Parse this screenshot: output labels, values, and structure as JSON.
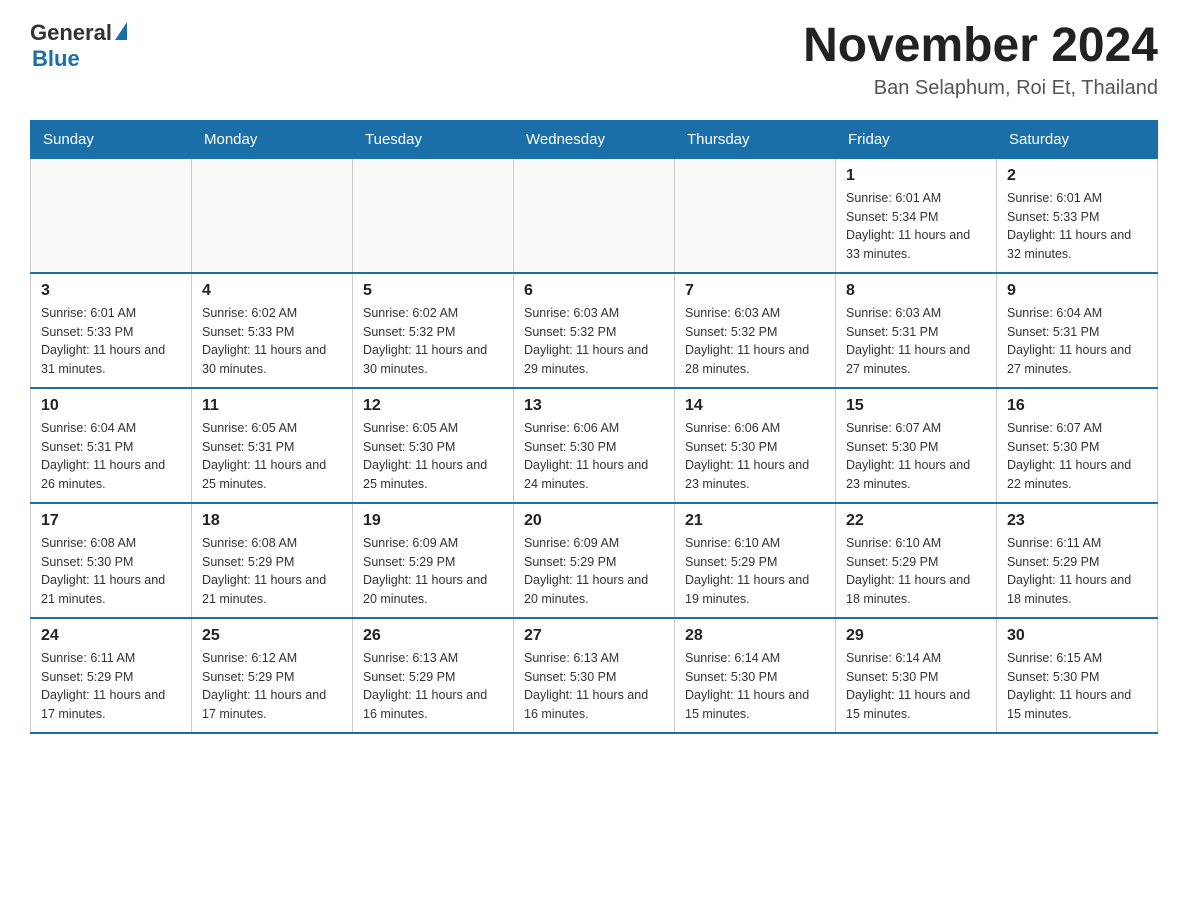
{
  "header": {
    "logo_general": "General",
    "logo_blue": "Blue",
    "month_title": "November 2024",
    "location": "Ban Selaphum, Roi Et, Thailand"
  },
  "weekdays": [
    "Sunday",
    "Monday",
    "Tuesday",
    "Wednesday",
    "Thursday",
    "Friday",
    "Saturday"
  ],
  "weeks": [
    [
      {
        "day": "",
        "info": ""
      },
      {
        "day": "",
        "info": ""
      },
      {
        "day": "",
        "info": ""
      },
      {
        "day": "",
        "info": ""
      },
      {
        "day": "",
        "info": ""
      },
      {
        "day": "1",
        "info": "Sunrise: 6:01 AM\nSunset: 5:34 PM\nDaylight: 11 hours and 33 minutes."
      },
      {
        "day": "2",
        "info": "Sunrise: 6:01 AM\nSunset: 5:33 PM\nDaylight: 11 hours and 32 minutes."
      }
    ],
    [
      {
        "day": "3",
        "info": "Sunrise: 6:01 AM\nSunset: 5:33 PM\nDaylight: 11 hours and 31 minutes."
      },
      {
        "day": "4",
        "info": "Sunrise: 6:02 AM\nSunset: 5:33 PM\nDaylight: 11 hours and 30 minutes."
      },
      {
        "day": "5",
        "info": "Sunrise: 6:02 AM\nSunset: 5:32 PM\nDaylight: 11 hours and 30 minutes."
      },
      {
        "day": "6",
        "info": "Sunrise: 6:03 AM\nSunset: 5:32 PM\nDaylight: 11 hours and 29 minutes."
      },
      {
        "day": "7",
        "info": "Sunrise: 6:03 AM\nSunset: 5:32 PM\nDaylight: 11 hours and 28 minutes."
      },
      {
        "day": "8",
        "info": "Sunrise: 6:03 AM\nSunset: 5:31 PM\nDaylight: 11 hours and 27 minutes."
      },
      {
        "day": "9",
        "info": "Sunrise: 6:04 AM\nSunset: 5:31 PM\nDaylight: 11 hours and 27 minutes."
      }
    ],
    [
      {
        "day": "10",
        "info": "Sunrise: 6:04 AM\nSunset: 5:31 PM\nDaylight: 11 hours and 26 minutes."
      },
      {
        "day": "11",
        "info": "Sunrise: 6:05 AM\nSunset: 5:31 PM\nDaylight: 11 hours and 25 minutes."
      },
      {
        "day": "12",
        "info": "Sunrise: 6:05 AM\nSunset: 5:30 PM\nDaylight: 11 hours and 25 minutes."
      },
      {
        "day": "13",
        "info": "Sunrise: 6:06 AM\nSunset: 5:30 PM\nDaylight: 11 hours and 24 minutes."
      },
      {
        "day": "14",
        "info": "Sunrise: 6:06 AM\nSunset: 5:30 PM\nDaylight: 11 hours and 23 minutes."
      },
      {
        "day": "15",
        "info": "Sunrise: 6:07 AM\nSunset: 5:30 PM\nDaylight: 11 hours and 23 minutes."
      },
      {
        "day": "16",
        "info": "Sunrise: 6:07 AM\nSunset: 5:30 PM\nDaylight: 11 hours and 22 minutes."
      }
    ],
    [
      {
        "day": "17",
        "info": "Sunrise: 6:08 AM\nSunset: 5:30 PM\nDaylight: 11 hours and 21 minutes."
      },
      {
        "day": "18",
        "info": "Sunrise: 6:08 AM\nSunset: 5:29 PM\nDaylight: 11 hours and 21 minutes."
      },
      {
        "day": "19",
        "info": "Sunrise: 6:09 AM\nSunset: 5:29 PM\nDaylight: 11 hours and 20 minutes."
      },
      {
        "day": "20",
        "info": "Sunrise: 6:09 AM\nSunset: 5:29 PM\nDaylight: 11 hours and 20 minutes."
      },
      {
        "day": "21",
        "info": "Sunrise: 6:10 AM\nSunset: 5:29 PM\nDaylight: 11 hours and 19 minutes."
      },
      {
        "day": "22",
        "info": "Sunrise: 6:10 AM\nSunset: 5:29 PM\nDaylight: 11 hours and 18 minutes."
      },
      {
        "day": "23",
        "info": "Sunrise: 6:11 AM\nSunset: 5:29 PM\nDaylight: 11 hours and 18 minutes."
      }
    ],
    [
      {
        "day": "24",
        "info": "Sunrise: 6:11 AM\nSunset: 5:29 PM\nDaylight: 11 hours and 17 minutes."
      },
      {
        "day": "25",
        "info": "Sunrise: 6:12 AM\nSunset: 5:29 PM\nDaylight: 11 hours and 17 minutes."
      },
      {
        "day": "26",
        "info": "Sunrise: 6:13 AM\nSunset: 5:29 PM\nDaylight: 11 hours and 16 minutes."
      },
      {
        "day": "27",
        "info": "Sunrise: 6:13 AM\nSunset: 5:30 PM\nDaylight: 11 hours and 16 minutes."
      },
      {
        "day": "28",
        "info": "Sunrise: 6:14 AM\nSunset: 5:30 PM\nDaylight: 11 hours and 15 minutes."
      },
      {
        "day": "29",
        "info": "Sunrise: 6:14 AM\nSunset: 5:30 PM\nDaylight: 11 hours and 15 minutes."
      },
      {
        "day": "30",
        "info": "Sunrise: 6:15 AM\nSunset: 5:30 PM\nDaylight: 11 hours and 15 minutes."
      }
    ]
  ]
}
